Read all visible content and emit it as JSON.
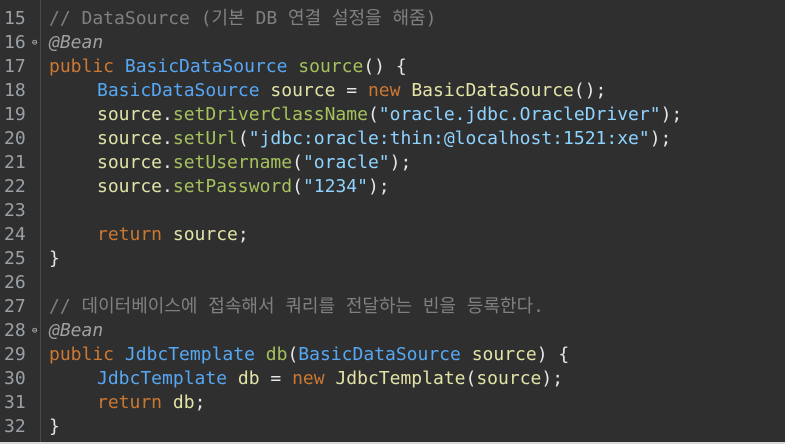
{
  "colors": {
    "background": "#2f2f2f",
    "comment": "#808080",
    "annotation": "#a0a0a0",
    "keyword": "#cc7832",
    "type": "#56a8f5",
    "method": "#a5c25c",
    "string": "#8fd3ff",
    "identifier": "#e3e3a8",
    "line_number": "#9aa0a6"
  },
  "lines": [
    {
      "num": "15",
      "fold": false,
      "indent": 1,
      "tokens": [
        {
          "t": "// DataSource (기본 DB 연결 설정을 해줌)",
          "k": "comment"
        }
      ]
    },
    {
      "num": "16",
      "fold": true,
      "indent": 1,
      "tokens": [
        {
          "t": "@Bean",
          "k": "annotation"
        }
      ]
    },
    {
      "num": "17",
      "fold": false,
      "indent": 1,
      "tokens": [
        {
          "t": "public",
          "k": "keyword"
        },
        {
          "t": " ",
          "k": "plain"
        },
        {
          "t": "BasicDataSource",
          "k": "type"
        },
        {
          "t": " ",
          "k": "plain"
        },
        {
          "t": "source",
          "k": "method"
        },
        {
          "t": "() {",
          "k": "plain"
        }
      ]
    },
    {
      "num": "18",
      "fold": false,
      "indent": 2,
      "tokens": [
        {
          "t": "BasicDataSource",
          "k": "type"
        },
        {
          "t": " ",
          "k": "plain"
        },
        {
          "t": "source",
          "k": "ident"
        },
        {
          "t": " = ",
          "k": "plain"
        },
        {
          "t": "new",
          "k": "keyword"
        },
        {
          "t": " ",
          "k": "plain"
        },
        {
          "t": "BasicDataSource",
          "k": "ident"
        },
        {
          "t": "();",
          "k": "plain"
        }
      ]
    },
    {
      "num": "19",
      "fold": false,
      "indent": 2,
      "tokens": [
        {
          "t": "source",
          "k": "ident"
        },
        {
          "t": ".",
          "k": "plain"
        },
        {
          "t": "setDriverClassName",
          "k": "method"
        },
        {
          "t": "(",
          "k": "plain"
        },
        {
          "t": "\"oracle.jdbc.OracleDriver\"",
          "k": "string"
        },
        {
          "t": ");",
          "k": "plain"
        }
      ]
    },
    {
      "num": "20",
      "fold": false,
      "indent": 2,
      "tokens": [
        {
          "t": "source",
          "k": "ident"
        },
        {
          "t": ".",
          "k": "plain"
        },
        {
          "t": "setUrl",
          "k": "method"
        },
        {
          "t": "(",
          "k": "plain"
        },
        {
          "t": "\"jdbc:oracle:thin:@localhost:1521:xe\"",
          "k": "string"
        },
        {
          "t": ");",
          "k": "plain"
        }
      ]
    },
    {
      "num": "21",
      "fold": false,
      "indent": 2,
      "tokens": [
        {
          "t": "source",
          "k": "ident"
        },
        {
          "t": ".",
          "k": "plain"
        },
        {
          "t": "setUsername",
          "k": "method"
        },
        {
          "t": "(",
          "k": "plain"
        },
        {
          "t": "\"oracle\"",
          "k": "string"
        },
        {
          "t": ");",
          "k": "plain"
        }
      ]
    },
    {
      "num": "22",
      "fold": false,
      "indent": 2,
      "tokens": [
        {
          "t": "source",
          "k": "ident"
        },
        {
          "t": ".",
          "k": "plain"
        },
        {
          "t": "setPassword",
          "k": "method"
        },
        {
          "t": "(",
          "k": "plain"
        },
        {
          "t": "\"1234\"",
          "k": "string"
        },
        {
          "t": ");",
          "k": "plain"
        }
      ]
    },
    {
      "num": "23",
      "fold": false,
      "indent": 0,
      "tokens": []
    },
    {
      "num": "24",
      "fold": false,
      "indent": 2,
      "tokens": [
        {
          "t": "return",
          "k": "keyword"
        },
        {
          "t": " ",
          "k": "plain"
        },
        {
          "t": "source",
          "k": "ident"
        },
        {
          "t": ";",
          "k": "plain"
        }
      ]
    },
    {
      "num": "25",
      "fold": false,
      "indent": 1,
      "tokens": [
        {
          "t": "}",
          "k": "plain"
        }
      ]
    },
    {
      "num": "26",
      "fold": false,
      "indent": 0,
      "tokens": []
    },
    {
      "num": "27",
      "fold": false,
      "indent": 1,
      "tokens": [
        {
          "t": "// 데이터베이스에 접속해서 쿼리를 전달하는 빈을 등록한다.",
          "k": "comment"
        }
      ]
    },
    {
      "num": "28",
      "fold": true,
      "indent": 1,
      "tokens": [
        {
          "t": "@Bean",
          "k": "annotation"
        }
      ]
    },
    {
      "num": "29",
      "fold": false,
      "indent": 1,
      "tokens": [
        {
          "t": "public",
          "k": "keyword"
        },
        {
          "t": " ",
          "k": "plain"
        },
        {
          "t": "JdbcTemplate",
          "k": "type"
        },
        {
          "t": " ",
          "k": "plain"
        },
        {
          "t": "db",
          "k": "method"
        },
        {
          "t": "(",
          "k": "plain"
        },
        {
          "t": "BasicDataSource",
          "k": "type"
        },
        {
          "t": " ",
          "k": "plain"
        },
        {
          "t": "source",
          "k": "ident"
        },
        {
          "t": ") {",
          "k": "plain"
        }
      ]
    },
    {
      "num": "30",
      "fold": false,
      "indent": 2,
      "tokens": [
        {
          "t": "JdbcTemplate",
          "k": "type"
        },
        {
          "t": " ",
          "k": "plain"
        },
        {
          "t": "db",
          "k": "ident"
        },
        {
          "t": " = ",
          "k": "plain"
        },
        {
          "t": "new",
          "k": "keyword"
        },
        {
          "t": " ",
          "k": "plain"
        },
        {
          "t": "JdbcTemplate",
          "k": "ident"
        },
        {
          "t": "(",
          "k": "plain"
        },
        {
          "t": "source",
          "k": "ident"
        },
        {
          "t": ");",
          "k": "plain"
        }
      ]
    },
    {
      "num": "31",
      "fold": false,
      "indent": 2,
      "tokens": [
        {
          "t": "return",
          "k": "keyword"
        },
        {
          "t": " ",
          "k": "plain"
        },
        {
          "t": "db",
          "k": "ident"
        },
        {
          "t": ";",
          "k": "plain"
        }
      ]
    },
    {
      "num": "32",
      "fold": false,
      "indent": 1,
      "tokens": [
        {
          "t": "}",
          "k": "plain"
        }
      ]
    }
  ]
}
